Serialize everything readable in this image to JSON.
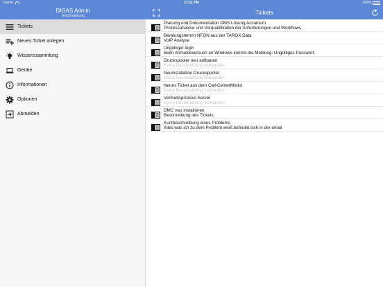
{
  "status_bar": {
    "carrier": "Carrier",
    "time": "12:11 PM",
    "battery": "100%"
  },
  "sidebar": {
    "title": "DIGAS Admin",
    "subtitle": "TestUmgebung",
    "items": [
      {
        "label": "Tickets",
        "icon": "list-icon",
        "active": true
      },
      {
        "label": "Neues Ticket anlegen",
        "icon": "add-list-icon"
      },
      {
        "label": "Wissenssammlung",
        "icon": "lightbulb-icon"
      },
      {
        "label": "Geräte",
        "icon": "laptop-icon"
      },
      {
        "label": "Informationen",
        "icon": "info-icon"
      },
      {
        "label": "Optionen",
        "icon": "gear-icon"
      },
      {
        "label": "Abmelden",
        "icon": "logout-icon"
      }
    ]
  },
  "main": {
    "title": "Tickets",
    "icons": {
      "left": "expand-icon",
      "right": "refresh-icon"
    },
    "tickets": [
      {
        "title": "Planung und Dokumentation DMS Lösung Accantum",
        "description": "Prozessanalyse und Vorqualifikation der Anforderungen und Workflows",
        "placeholder": false
      },
      {
        "title": "Beratungstermin NFON aus der TAROX Data",
        "description": "VoIP Analyse",
        "placeholder": false
      },
      {
        "title": "Ungültiger login",
        "description": "Beim Anmeldeversuch an Windows kommt die Meldung: Ungültiges Passwort.",
        "placeholder": false
      },
      {
        "title": "Druckspooler neu aufbauen",
        "description": "Keine Beschreibung vorhanden",
        "placeholder": true
      },
      {
        "title": "Neuinstallation Druckspooler",
        "description": "Keine Beschreibung vorhanden",
        "placeholder": true
      },
      {
        "title": "Neues Ticket aus dem Call-CenterModul",
        "description": "Keine Beschreibung vorhanden",
        "placeholder": true
      },
      {
        "title": "Vertriebsprozess Server",
        "description": "Keine Beschreibung vorhanden",
        "placeholder": true
      },
      {
        "title": "DMC neu installieren",
        "description": "Beschreibung des Tickets",
        "placeholder": false
      },
      {
        "title": "Kurzbeschreibung eines Problems",
        "description": "Alles was ich zu dem Problem weiß befindet sich in der email",
        "placeholder": false
      }
    ]
  },
  "colors": {
    "header": "#5b87d6",
    "sidebar_bg": "#f7f7f7",
    "active_item": "#dcdcdc",
    "placeholder_text": "#c4c4c4"
  }
}
